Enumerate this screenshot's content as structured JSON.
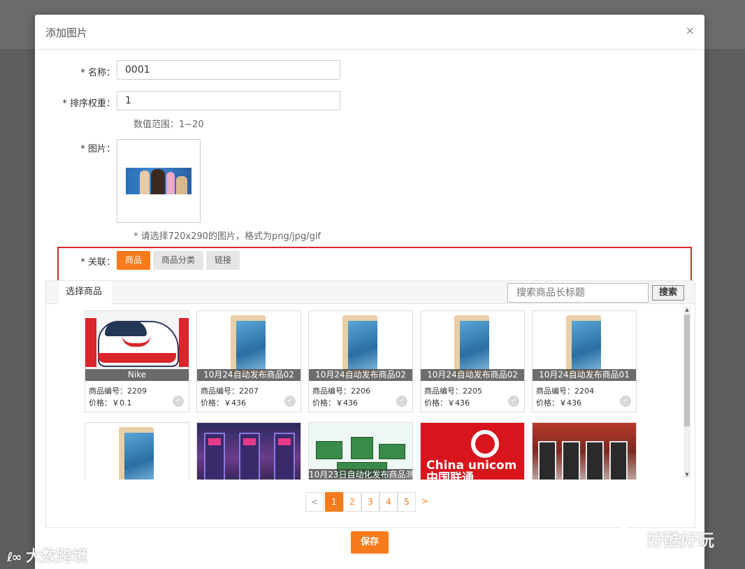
{
  "modal": {
    "title": "添加图片",
    "close_glyph": "×"
  },
  "form": {
    "name_label": "* 名称：",
    "name_value": "0001",
    "sort_label": "* 排序权重：",
    "sort_value": "1",
    "sort_hint": "数值范围：1~20",
    "image_label": "* 图片：",
    "image_hint": "* 请选择720x290的图片，格式为png/jpg/gif",
    "link_label": "* 关联："
  },
  "link_tabs": [
    "商品",
    "商品分类",
    "链接"
  ],
  "product_panel": {
    "tab_label": "选择商品",
    "search_placeholder": "搜索商品长标题",
    "search_button": "搜索"
  },
  "products": [
    {
      "caption": "Nike",
      "code_label": "商品编号：2209",
      "price_label": "价格：￥0.1",
      "image": "sneaker"
    },
    {
      "caption": "10月24自动发布商品02",
      "code_label": "商品编号：2207",
      "price_label": "价格：￥436",
      "image": "ipad"
    },
    {
      "caption": "10月24自动发布商品02",
      "code_label": "商品编号：2206",
      "price_label": "价格：￥436",
      "image": "ipad"
    },
    {
      "caption": "10月24自动发布商品02",
      "code_label": "商品编号：2205",
      "price_label": "价格：￥436",
      "image": "ipad"
    },
    {
      "caption": "10月24自动发布商品01",
      "code_label": "商品编号：2204",
      "price_label": "价格：￥436",
      "image": "ipad"
    },
    {
      "caption": "",
      "image": "ipad"
    },
    {
      "caption": "",
      "image": "ticket-machines"
    },
    {
      "caption": "10月23日自动化发布商品测",
      "image": "circuit-boards"
    },
    {
      "caption": "",
      "image": "china-unicom",
      "image_text": "China unicom中国联通"
    },
    {
      "caption": "",
      "image": "vending-machines"
    }
  ],
  "pagination": {
    "prev": "<",
    "pages": [
      "1",
      "2",
      "3",
      "4",
      "5"
    ],
    "current": "1",
    "next": ">"
  },
  "save_button": "保存",
  "watermarks": {
    "left": "大数跨境",
    "right": "好酷好玩"
  },
  "colors": {
    "accent": "#f77b1d",
    "highlight_frame": "#d9262c"
  }
}
